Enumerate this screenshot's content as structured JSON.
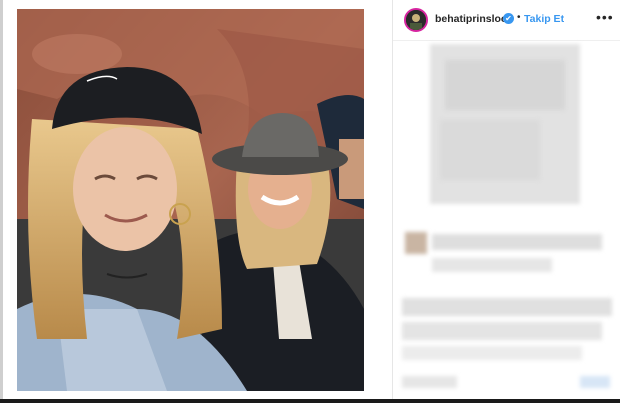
{
  "post": {
    "username": "behatiprinsloo",
    "verified_mark": "✔",
    "separator": "•",
    "follow_label": "Takip Et",
    "more_label": "•••"
  },
  "icons": {
    "verified": "verified-badge-icon",
    "more": "more-options-icon"
  },
  "colors": {
    "accent": "#3897f0",
    "text": "#262626",
    "story_ring": "#d6249f"
  }
}
